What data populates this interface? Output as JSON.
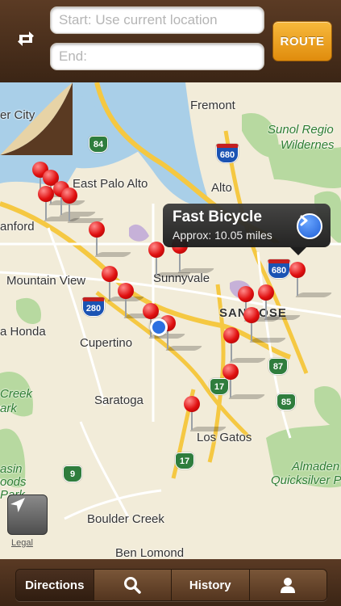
{
  "header": {
    "start_placeholder": "Start: Use current location",
    "end_placeholder": "End:",
    "route_label": "ROUTE",
    "swap_icon": "swap-arrows-icon"
  },
  "map": {
    "places": [
      {
        "name": "er City",
        "style": "city"
      },
      {
        "name": "Fremont",
        "style": "city"
      },
      {
        "name": "East Palo Alto",
        "style": "city"
      },
      {
        "name": "Alto",
        "style": "city"
      },
      {
        "name": "anford",
        "style": "city"
      },
      {
        "name": "Mountain View",
        "style": "city"
      },
      {
        "name": "Sunnyvale",
        "style": "city"
      },
      {
        "name": "SAN JOSE",
        "style": "city"
      },
      {
        "name": "Cupertino",
        "style": "city"
      },
      {
        "name": "a Honda",
        "style": "city"
      },
      {
        "name": "Saratoga",
        "style": "city"
      },
      {
        "name": "Los Gatos",
        "style": "city"
      },
      {
        "name": "Boulder Creek",
        "style": "city"
      },
      {
        "name": "Ben Lomond",
        "style": "city"
      },
      {
        "name": "Sunol Regio",
        "style": "park"
      },
      {
        "name": "Wildernes",
        "style": "park"
      },
      {
        "name": "Creek",
        "style": "park"
      },
      {
        "name": "ark",
        "style": "park"
      },
      {
        "name": "asin",
        "style": "park"
      },
      {
        "name": "oods",
        "style": "park"
      },
      {
        "name": "Park",
        "style": "park"
      },
      {
        "name": "Almaden",
        "style": "park"
      },
      {
        "name": "Quicksilver Par",
        "style": "park"
      }
    ],
    "shields": [
      {
        "label": "84",
        "type": "state"
      },
      {
        "label": "680",
        "type": "interstate"
      },
      {
        "label": "280",
        "type": "interstate"
      },
      {
        "label": "680",
        "type": "interstate"
      },
      {
        "label": "87",
        "type": "state"
      },
      {
        "label": "17",
        "type": "state"
      },
      {
        "label": "85",
        "type": "state"
      },
      {
        "label": "17",
        "type": "state"
      },
      {
        "label": "9",
        "type": "state"
      }
    ],
    "callout": {
      "title": "Fast Bicycle",
      "subtitle": "Approx: 10.05 miles",
      "icon": "disclosure-arrow-icon"
    },
    "pin_count": 20,
    "legal_label": "Legal",
    "locate_icon": "location-arrow-icon"
  },
  "tabs": [
    {
      "label": "Directions",
      "icon": "",
      "active": true
    },
    {
      "label": "",
      "icon": "search-icon",
      "active": false
    },
    {
      "label": "History",
      "icon": "",
      "active": false
    },
    {
      "label": "",
      "icon": "person-icon",
      "active": false
    }
  ],
  "colors": {
    "route_button": "#f0a623",
    "pin": "#e01010",
    "callout_bg": "#2a2a2a",
    "bar_brown": "#4a2f1c"
  }
}
